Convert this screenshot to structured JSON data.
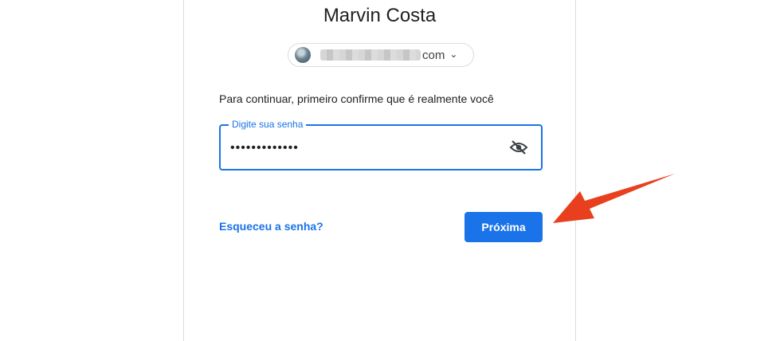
{
  "account": {
    "name": "Marvin Costa",
    "email_suffix": "com"
  },
  "form": {
    "prompt": "Para continuar, primeiro confirme que é realmente você",
    "password_label": "Digite sua senha",
    "password_value": "•••••••••••••"
  },
  "actions": {
    "forgot_label": "Esqueceu a senha?",
    "next_label": "Próxima"
  },
  "colors": {
    "accent": "#1a73e8",
    "annotation_arrow": "#e8401f"
  },
  "icons": {
    "visibility_toggle": "eye-off-icon",
    "account_menu": "chevron-down-icon"
  }
}
